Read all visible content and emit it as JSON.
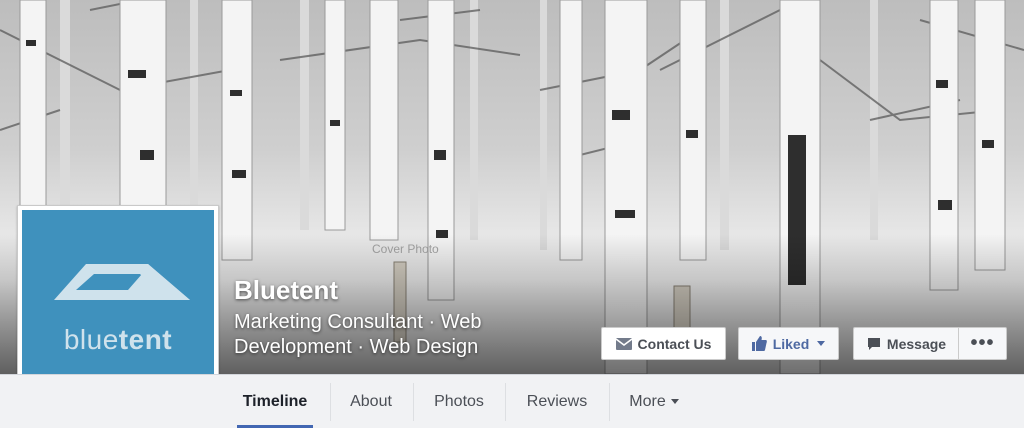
{
  "cover": {
    "hint_text": "Cover Photo"
  },
  "profile": {
    "logo_text_part1": "blue",
    "logo_text_part2": "tent",
    "name": "Bluetent",
    "category": "Marketing Consultant · Web Development · Web Design"
  },
  "actions": {
    "contact_label": "Contact Us",
    "liked_label": "Liked",
    "message_label": "Message",
    "more_label": "•••"
  },
  "nav": {
    "items": [
      {
        "label": "Timeline"
      },
      {
        "label": "About"
      },
      {
        "label": "Photos"
      },
      {
        "label": "Reviews"
      },
      {
        "label": "More"
      }
    ],
    "active": "Timeline"
  },
  "colors": {
    "logo_blue": "#3f91bd",
    "facebook_blue": "#4267b2",
    "liked_text": "#4e69a2"
  },
  "icons": {
    "contact": "envelope-icon",
    "liked": "thumbs-up-icon",
    "message": "speech-bubble-icon",
    "more": "chevron-down-icon"
  }
}
